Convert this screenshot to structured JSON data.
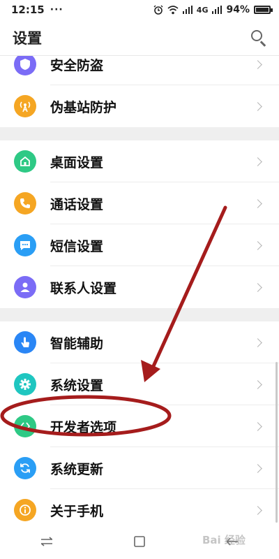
{
  "status_bar": {
    "time": "12:15",
    "dots": "···",
    "network": "4G",
    "battery": "94%",
    "battery_level": 0.94
  },
  "header": {
    "title": "设置",
    "search_icon": "search-icon"
  },
  "sections": [
    {
      "items": [
        {
          "label": "安全防盗",
          "icon": "shield-icon",
          "color": "#7b6cf6"
        },
        {
          "label": "伪基站防护",
          "icon": "signal-tower-icon",
          "color": "#f5a623"
        }
      ]
    },
    {
      "items": [
        {
          "label": "桌面设置",
          "icon": "home-icon",
          "color": "#2ec985"
        },
        {
          "label": "通话设置",
          "icon": "phone-icon",
          "color": "#f5a623"
        },
        {
          "label": "短信设置",
          "icon": "message-icon",
          "color": "#2a9ef5"
        },
        {
          "label": "联系人设置",
          "icon": "contact-icon",
          "color": "#7b6cf6"
        }
      ]
    },
    {
      "items": [
        {
          "label": "智能辅助",
          "icon": "hand-tap-icon",
          "color": "#2a86f5"
        },
        {
          "label": "系统设置",
          "icon": "gear-icon",
          "color": "#1fc6c0"
        },
        {
          "label": "开发者选项",
          "icon": "code-brackets-icon",
          "color": "#2ec985"
        },
        {
          "label": "系统更新",
          "icon": "refresh-icon",
          "color": "#2a9ef5"
        },
        {
          "label": "关于手机",
          "icon": "info-icon",
          "color": "#f5a623"
        }
      ]
    }
  ],
  "nav_bar": {
    "icons": [
      "menu-icon",
      "home-square-icon",
      "back-icon"
    ],
    "watermark": "Bai 经验"
  },
  "annotation_color": "#a51c1c"
}
